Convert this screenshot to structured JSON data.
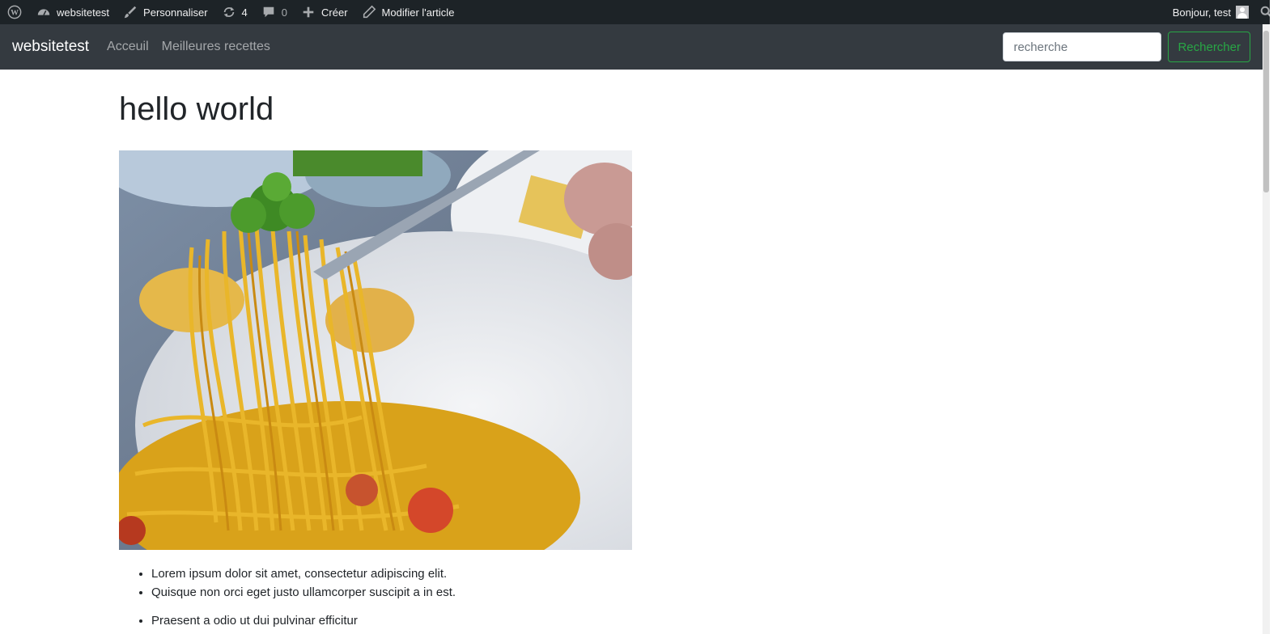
{
  "adminbar": {
    "site_name": "websitetest",
    "customize_label": "Personnaliser",
    "updates_count": "4",
    "comments_count": "0",
    "new_label": "Créer",
    "edit_label": "Modifier l'article",
    "greeting": "Bonjour, test"
  },
  "navbar": {
    "brand": "websitetest",
    "links": [
      "Acceuil",
      "Meilleures recettes"
    ],
    "search_placeholder": "recherche",
    "search_button": "Rechercher"
  },
  "post": {
    "title": "hello world",
    "list1": [
      "Lorem ipsum dolor sit amet, consectetur adipiscing elit.",
      "Quisque non orci eget justo ullamcorper suscipit a in est."
    ],
    "list2": [
      "Praesent a odio ut dui pulvinar efficitur"
    ]
  },
  "colors": {
    "adminbar_bg": "#1d2327",
    "navbar_bg": "#343a40",
    "search_button": "#28a745"
  },
  "icons": {
    "wp_logo": "wordpress-icon",
    "dashboard": "dashboard-icon",
    "customize": "brush-icon",
    "updates": "updates-icon",
    "comments": "comment-icon",
    "new": "plus-icon",
    "edit": "pencil-icon",
    "search": "search-icon"
  }
}
